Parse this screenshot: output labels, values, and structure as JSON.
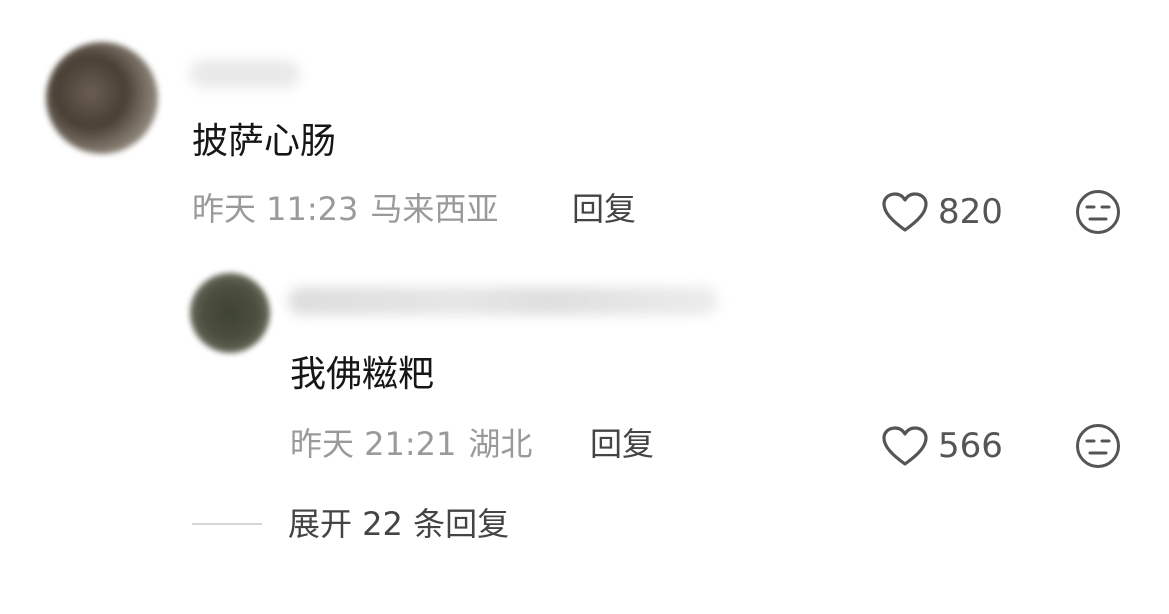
{
  "comment": {
    "text": "披萨心肠",
    "time": "昨天 11:23",
    "location": "马来西亚",
    "reply_label": "回复",
    "likes": "820"
  },
  "reply": {
    "text": "我佛糍粑",
    "time": "昨天 21:21",
    "location": "湖北",
    "reply_label": "回复",
    "likes": "566"
  },
  "expand_label": "展开 22 条回复",
  "icons": {
    "like": "heart-outline-icon",
    "dislike": "unamused-face-icon"
  },
  "colors": {
    "text": "#161616",
    "meta": "#9a9a9a",
    "action": "#444444",
    "icon": "#555555"
  }
}
